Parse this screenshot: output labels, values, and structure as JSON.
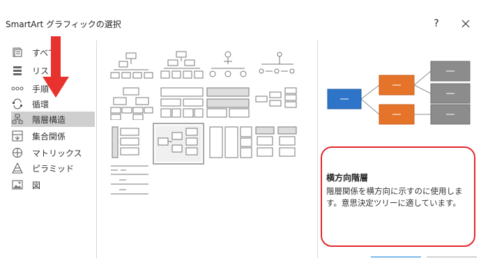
{
  "window": {
    "title": "SmartArt グラフィックの選択",
    "help_label": "?"
  },
  "categories": [
    {
      "label": "すべて",
      "icon": "all-icon",
      "selected": false
    },
    {
      "label": "リスト",
      "icon": "list-icon",
      "selected": false
    },
    {
      "label": "手順",
      "icon": "process-icon",
      "selected": false
    },
    {
      "label": "循環",
      "icon": "cycle-icon",
      "selected": false
    },
    {
      "label": "階層構造",
      "icon": "hierarchy-icon",
      "selected": true
    },
    {
      "label": "集合関係",
      "icon": "relationship-icon",
      "selected": false
    },
    {
      "label": "マトリックス",
      "icon": "matrix-icon",
      "selected": false
    },
    {
      "label": "ピラミッド",
      "icon": "pyramid-icon",
      "selected": false
    },
    {
      "label": "図",
      "icon": "picture-icon",
      "selected": false
    }
  ],
  "preview": {
    "title": "横方向階層",
    "description": "階層関係を横方向に示すのに使用します。意思決定ツリーに適しています。",
    "colors": {
      "root": "#2e74c8",
      "mid": "#e5742a",
      "leaf": "#8c8c8c"
    }
  },
  "colors": {
    "selected_bg": "#cfcfcf",
    "highlight": "#e0282e",
    "arrow": "#e8322e"
  }
}
